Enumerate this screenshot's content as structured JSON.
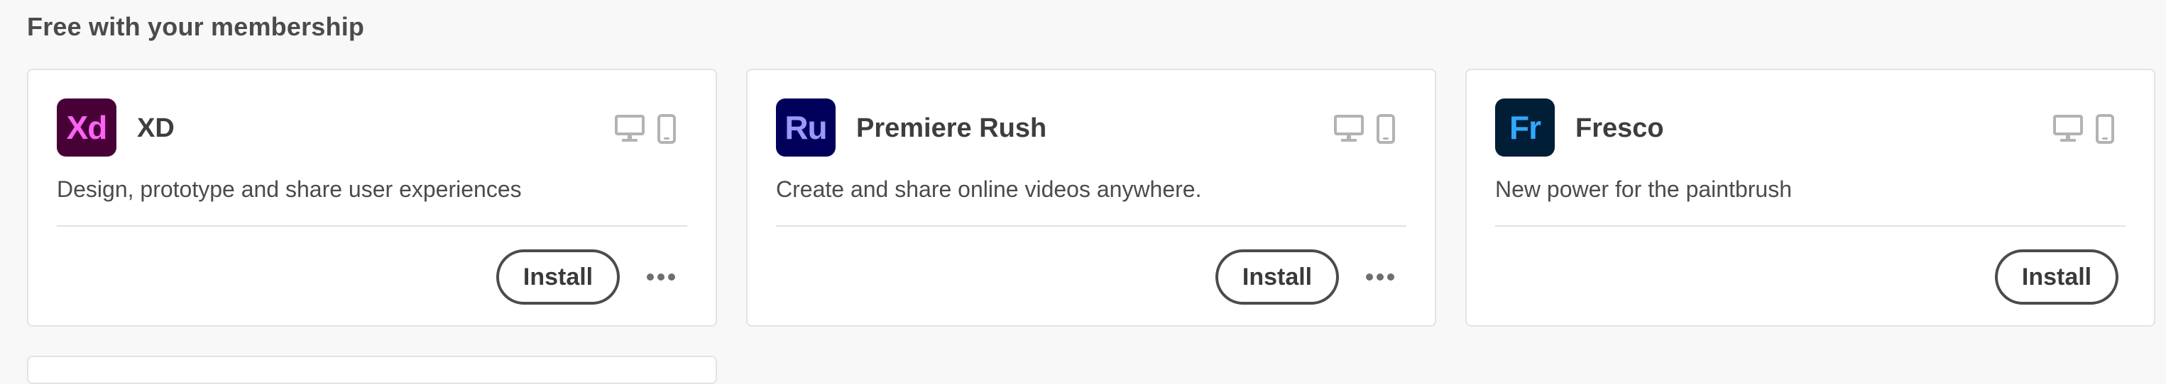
{
  "section": {
    "title": "Free with your membership"
  },
  "apps": [
    {
      "icon_text": "Xd",
      "icon_name": "adobe-xd-icon",
      "icon_bg": "#470137",
      "icon_fg": "#FF61F6",
      "name": "XD",
      "description": "Design, prototype and share user experiences",
      "platforms": [
        "desktop-icon",
        "mobile-icon"
      ],
      "install_label": "Install",
      "has_more_menu": true
    },
    {
      "icon_text": "Ru",
      "icon_name": "adobe-premiere-rush-icon",
      "icon_bg": "#00005B",
      "icon_fg": "#9999FF",
      "name": "Premiere Rush",
      "description": "Create and share online videos anywhere.",
      "platforms": [
        "desktop-icon",
        "mobile-icon"
      ],
      "install_label": "Install",
      "has_more_menu": true
    },
    {
      "icon_text": "Fr",
      "icon_name": "adobe-fresco-icon",
      "icon_bg": "#001E36",
      "icon_fg": "#31A8FF",
      "name": "Fresco",
      "description": "New power for the paintbrush",
      "platforms": [
        "desktop-icon",
        "mobile-icon"
      ],
      "install_label": "Install",
      "has_more_menu": false
    }
  ]
}
